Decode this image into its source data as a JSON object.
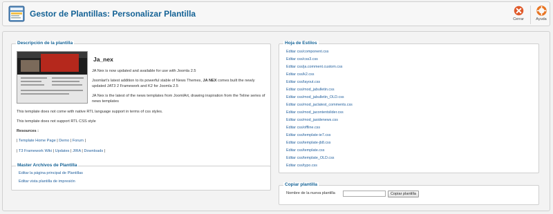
{
  "header": {
    "title": "Gestor de Plantillas: Personalizar Plantilla",
    "close_label": "Cerrar",
    "help_label": "Ayuda"
  },
  "description": {
    "legend": "Descripción de la plantilla",
    "template_name": "Ja_nex",
    "para1": "JA Nex is now updated and available for use with Joomla 2.5",
    "para2_part1": "Joomlart's latest addition to its powerful stable of News Themes, ",
    "para2_bold": "JA NEX",
    "para2_part2": " comes built the newly updated JAT3 2 Framework and K2 for Joomla 2.5",
    "para3": "JA Nex is the latest of the news templates from JoomlArt, drawing inspiration from the Teline series of news templates",
    "rtl1": "This template does not come with native RTL language support in terms of css styles.",
    "rtl2": "This template does not support RTL CSS style",
    "resources_label": "Resources :",
    "links_row1": [
      "Template Home Page",
      "Demo",
      "Forum"
    ],
    "links_row2": [
      "T3 Framework Wiki",
      "Updates",
      "JIRA",
      "Downloads"
    ]
  },
  "master": {
    "legend": "Master Archivos de Plantilla",
    "links": [
      "Editar la página principal de Plantillas",
      "Editar vista plantilla de impresión"
    ]
  },
  "styles": {
    "legend": "Hoja de Estilos",
    "files": [
      "Editar css/component.css",
      "Editar css/css3.css",
      "Editar css/ja.comment.custom.css",
      "Editar css/k2.css",
      "Editar css/layout.css",
      "Editar css/mod_jabulletin.css",
      "Editar css/mod_jabulletin_OLD.css",
      "Editar css/mod_jaclatest_comments.css",
      "Editar css/mod_jacontentslider.css",
      "Editar css/mod_jasidenews.css",
      "Editar css/offline.css",
      "Editar css/template-ie7.css",
      "Editar css/template-jb8.css",
      "Editar css/template.css",
      "Editar css/template_OLD.css",
      "Editar css/typo.css"
    ]
  },
  "copy": {
    "legend": "Copiar plantilla",
    "field_label": "Nombre de la nueva plantilla",
    "field_value": "",
    "button_label": "Copiar plantilla"
  },
  "colors": {
    "title": "#146295",
    "link": "#1f5e9c",
    "close_icon": "#e05a2b",
    "help_icon": "#e87523"
  },
  "icons": [
    "template-manager-icon",
    "close-icon",
    "help-icon"
  ]
}
